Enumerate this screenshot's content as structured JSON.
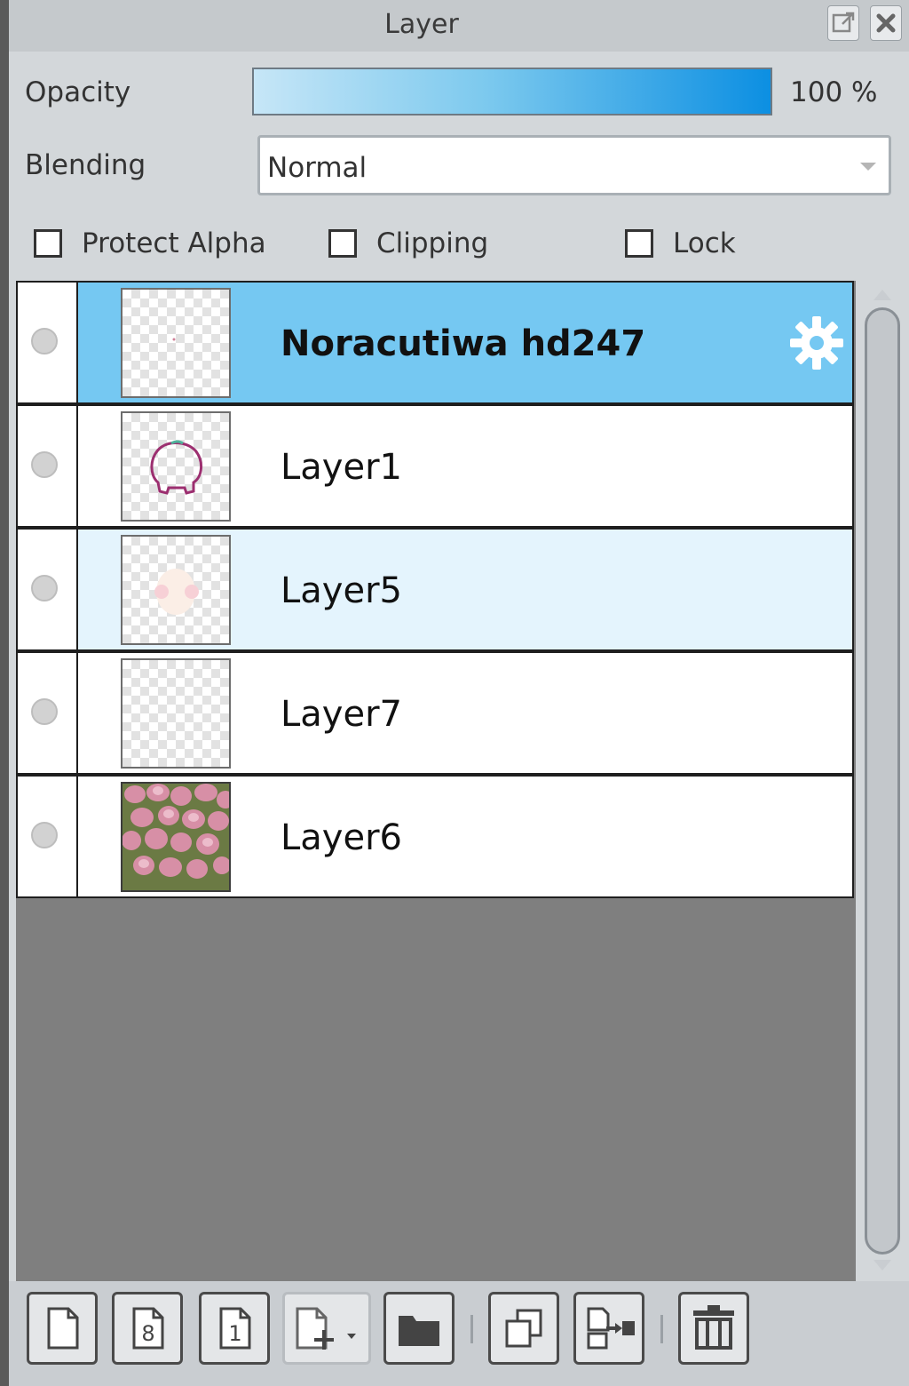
{
  "panel": {
    "title": "Layer",
    "title_icons": [
      "popout-icon",
      "close-icon"
    ]
  },
  "opacity": {
    "label": "Opacity",
    "value_text": "100 %",
    "value_percent": 100
  },
  "blending": {
    "label": "Blending",
    "selected": "Normal"
  },
  "options": [
    {
      "label": "Protect Alpha",
      "checked": false
    },
    {
      "label": "Clipping",
      "checked": false
    },
    {
      "label": "Lock",
      "checked": false
    }
  ],
  "layers": [
    {
      "name": "Noracutiwa hd247",
      "selected": true,
      "bold": true,
      "thumbnail": "mostly-transparent",
      "settings_icon": "gear-icon"
    },
    {
      "name": "Layer1",
      "selected": false,
      "thumbnail": "character-outline-sketch"
    },
    {
      "name": "Layer5",
      "selected": false,
      "highlighted": true,
      "thumbnail": "pale-pink-blob"
    },
    {
      "name": "Layer7",
      "selected": false,
      "thumbnail": "empty-transparent"
    },
    {
      "name": "Layer6",
      "selected": false,
      "thumbnail": "pink-tulips-photo"
    }
  ],
  "colors": {
    "selected_row": "#75c8f2",
    "highlighted_row": "#e4f4fd",
    "panel_bg": "#d3d7da",
    "empty_area": "#7f7f7f"
  },
  "toolbar": {
    "buttons": [
      "new-layer-icon",
      "new-8bit-layer-icon",
      "new-1bit-layer-icon",
      "add-layer-dropdown-icon",
      "new-folder-icon",
      "duplicate-layer-icon",
      "merge-down-icon",
      "delete-layer-icon"
    ]
  }
}
